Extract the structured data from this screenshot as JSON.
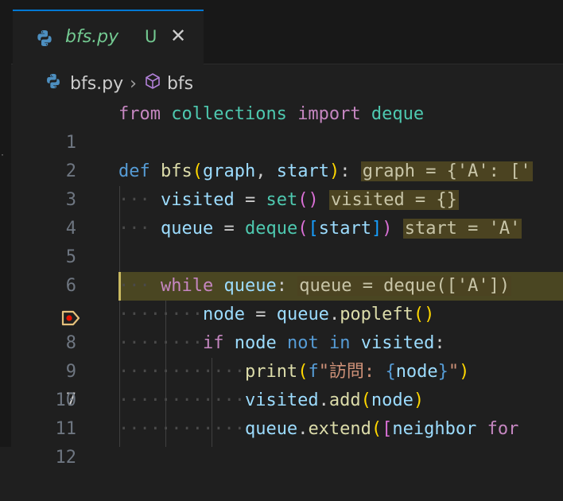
{
  "tab": {
    "filename": "bfs.py",
    "status": "U",
    "close_glyph": "✕"
  },
  "breadcrumb": {
    "file": "bfs.py",
    "separator": "›",
    "symbol": "bfs"
  },
  "lines": [
    {
      "n": "1"
    },
    {
      "n": "2"
    },
    {
      "n": "3"
    },
    {
      "n": "4"
    },
    {
      "n": "5"
    },
    {
      "n": "6"
    },
    {
      "n": "7"
    },
    {
      "n": "8"
    },
    {
      "n": "9"
    },
    {
      "n": "10"
    },
    {
      "n": "11"
    },
    {
      "n": "12"
    }
  ],
  "inline_values": {
    "line3": "graph = {'A': ['",
    "line4": "visited = {}",
    "line5": "start = 'A'",
    "line7": "queue = deque(['A'])"
  },
  "debug": {
    "current_line": "7",
    "breakpoint_icon": "debug-stackframe-icon"
  },
  "colors": {
    "tab_active_border": "#0078d4",
    "untracked_green": "#73c991",
    "current_line_highlight": "#4a4622"
  }
}
